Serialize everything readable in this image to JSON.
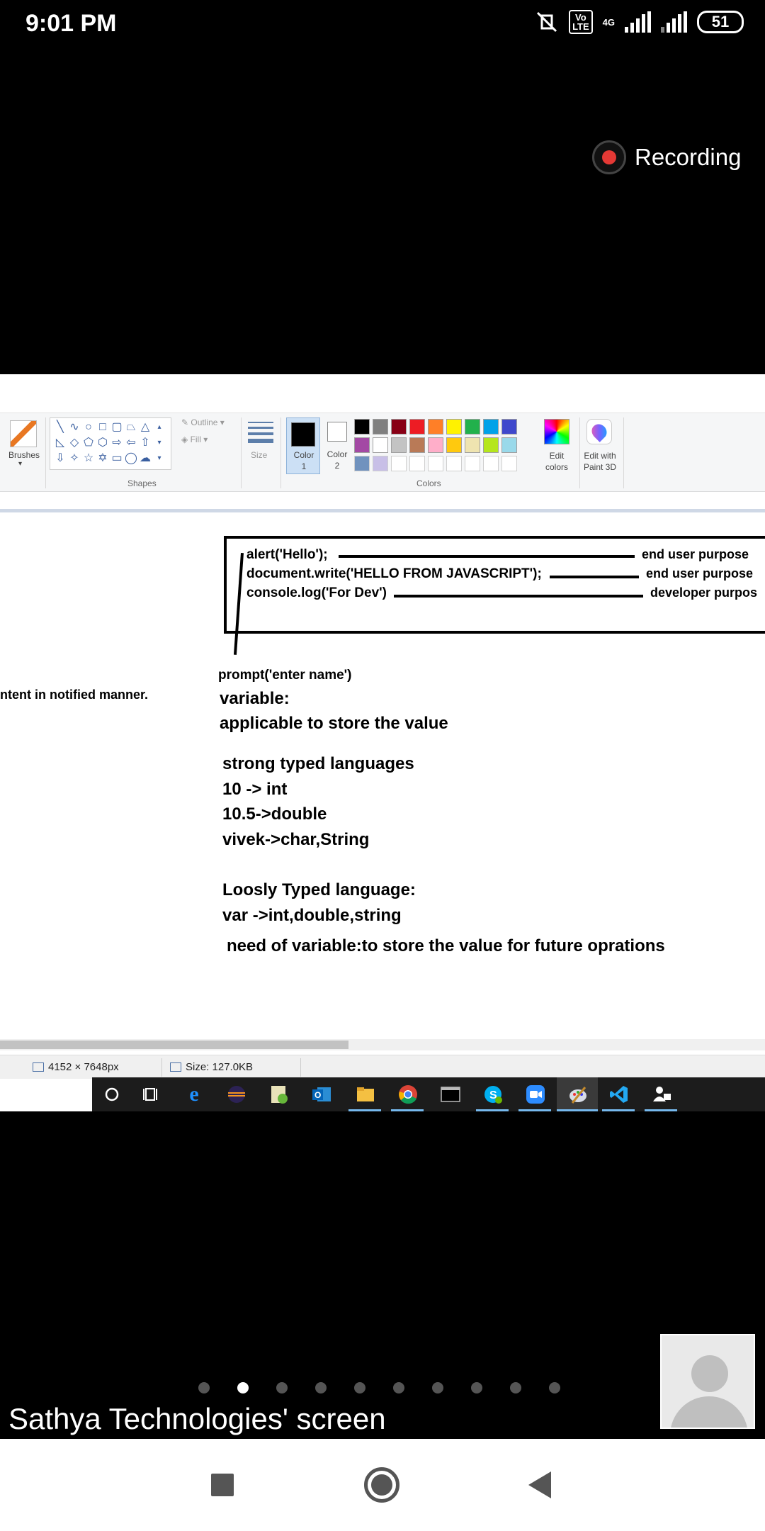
{
  "status_bar": {
    "time": "9:01 PM",
    "volte_label": "Vo\nLTE",
    "network_label": "4G",
    "battery": "51"
  },
  "recording": {
    "label": "Recording"
  },
  "paint": {
    "ribbon": {
      "brushes_label": "Brushes",
      "outline_label": "Outline",
      "fill_label": "Fill",
      "shapes_group": "Shapes",
      "size_label": "Size",
      "color1_label": "Color\n1",
      "color2_label": "Color\n2",
      "edit_colors_label": "Edit\ncolors",
      "paint3d_label": "Edit with\nPaint 3D",
      "colors_group": "Colors",
      "palette": [
        "#000000",
        "#7f7f7f",
        "#880015",
        "#ed1c24",
        "#ff7f27",
        "#fff200",
        "#22b14c",
        "#00a2e8",
        "#3f48cc",
        "#a349a4",
        "#ffffff",
        "#c3c3c3",
        "#b97a57",
        "#ffaec9",
        "#ffc90e",
        "#efe4b0",
        "#b5e61d",
        "#99d9ea",
        "#7092be",
        "#c8bfe7"
      ]
    },
    "canvas": {
      "code_lines": [
        "alert('Hello');",
        "document.write('HELLO FROM JAVASCRIPT');",
        "console.log('For Dev')"
      ],
      "purposes": [
        "end user purpose",
        "end user purpose",
        "developer purpos"
      ],
      "left_cut_text": "ntent in notified manner.",
      "prompt_line": "prompt('enter name')",
      "variable_heading": "variable:",
      "variable_desc": "applicable to store the value",
      "strong_heading": "strong typed languages",
      "strong_items": [
        "10 -> int",
        "10.5->double",
        "vivek->char,String"
      ],
      "loose_heading": "Loosly Typed language:",
      "loose_item": "var ->int,double,string",
      "need_line": "need of variable:to store the value for future oprations"
    },
    "status": {
      "dimensions": "4152 × 7648px",
      "size": "Size: 127.0KB"
    }
  },
  "meeting": {
    "screen_owner": "Sathya Technologies' screen",
    "page_count": 10,
    "active_page": 2
  }
}
